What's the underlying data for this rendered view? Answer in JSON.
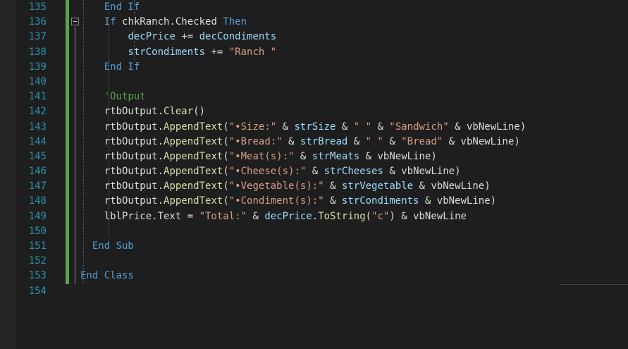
{
  "colors": {
    "background": "#1e1e1e",
    "line_number": "#2b91af",
    "keyword": "#569cd6",
    "string": "#d69d85",
    "comment": "#57a64a",
    "variable": "#9cdcfe",
    "method": "#dcdcaa",
    "change_bar": "#57a64a"
  },
  "lines": [
    {
      "n": "135",
      "indent": "    ",
      "t": [
        [
          "kw",
          "End If"
        ]
      ]
    },
    {
      "n": "136",
      "indent": "    ",
      "t": [
        [
          "kw",
          "If "
        ],
        [
          "d",
          "chkRanch.Checked "
        ],
        [
          "kw",
          "Then"
        ]
      ]
    },
    {
      "n": "137",
      "indent": "        ",
      "t": [
        [
          "var",
          "decPrice"
        ],
        [
          "d",
          " += "
        ],
        [
          "var",
          "decCondiments"
        ]
      ]
    },
    {
      "n": "138",
      "indent": "        ",
      "t": [
        [
          "var",
          "strCondiments"
        ],
        [
          "d",
          " += "
        ],
        [
          "str",
          "\"Ranch \""
        ]
      ]
    },
    {
      "n": "139",
      "indent": "    ",
      "t": [
        [
          "kw",
          "End If"
        ]
      ]
    },
    {
      "n": "140",
      "indent": "",
      "t": []
    },
    {
      "n": "141",
      "indent": "    ",
      "t": [
        [
          "cm",
          "'Output"
        ]
      ]
    },
    {
      "n": "142",
      "indent": "    ",
      "t": [
        [
          "d",
          "rtbOutput."
        ],
        [
          "mth",
          "Clear"
        ],
        [
          "d",
          "()"
        ]
      ]
    },
    {
      "n": "143",
      "indent": "    ",
      "t": [
        [
          "d",
          "rtbOutput."
        ],
        [
          "mth",
          "AppendText"
        ],
        [
          "d",
          "("
        ],
        [
          "str",
          "\"•Size:\""
        ],
        [
          "d",
          " & "
        ],
        [
          "var",
          "strSize"
        ],
        [
          "d",
          " & "
        ],
        [
          "str",
          "\" \""
        ],
        [
          "d",
          " & "
        ],
        [
          "str",
          "\"Sandwich\""
        ],
        [
          "d",
          " & vbNewLine)"
        ]
      ]
    },
    {
      "n": "144",
      "indent": "    ",
      "t": [
        [
          "d",
          "rtbOutput."
        ],
        [
          "mth",
          "AppendText"
        ],
        [
          "d",
          "("
        ],
        [
          "str",
          "\"•Bread:\""
        ],
        [
          "d",
          " & "
        ],
        [
          "var",
          "strBread"
        ],
        [
          "d",
          " & "
        ],
        [
          "str",
          "\" \""
        ],
        [
          "d",
          " & "
        ],
        [
          "str",
          "\"Bread\""
        ],
        [
          "d",
          " & vbNewLine)"
        ]
      ]
    },
    {
      "n": "145",
      "indent": "    ",
      "t": [
        [
          "d",
          "rtbOutput."
        ],
        [
          "mth",
          "AppendText"
        ],
        [
          "d",
          "("
        ],
        [
          "str",
          "\"•Meat(s):\""
        ],
        [
          "d",
          " & "
        ],
        [
          "var",
          "strMeats"
        ],
        [
          "d",
          " & vbNewLine)"
        ]
      ]
    },
    {
      "n": "146",
      "indent": "    ",
      "t": [
        [
          "d",
          "rtbOutput."
        ],
        [
          "mth",
          "AppendText"
        ],
        [
          "d",
          "("
        ],
        [
          "str",
          "\"•Cheese(s):\""
        ],
        [
          "d",
          " & "
        ],
        [
          "var",
          "strCheeses"
        ],
        [
          "d",
          " & vbNewLine)"
        ]
      ]
    },
    {
      "n": "147",
      "indent": "    ",
      "t": [
        [
          "d",
          "rtbOutput."
        ],
        [
          "mth",
          "AppendText"
        ],
        [
          "d",
          "("
        ],
        [
          "str",
          "\"•Vegetable(s):\""
        ],
        [
          "d",
          " & "
        ],
        [
          "var",
          "strVegetable"
        ],
        [
          "d",
          " & vbNewLine)"
        ]
      ]
    },
    {
      "n": "148",
      "indent": "    ",
      "t": [
        [
          "d",
          "rtbOutput."
        ],
        [
          "mth",
          "AppendText"
        ],
        [
          "d",
          "("
        ],
        [
          "str",
          "\"•Condiment(s):\""
        ],
        [
          "d",
          " & "
        ],
        [
          "var",
          "strCondiments"
        ],
        [
          "d",
          " & vbNewLine)"
        ]
      ]
    },
    {
      "n": "149",
      "indent": "    ",
      "t": [
        [
          "d",
          "lblPrice.Text = "
        ],
        [
          "str",
          "\"Total:\""
        ],
        [
          "d",
          " & "
        ],
        [
          "var",
          "decPrice"
        ],
        [
          "d",
          "."
        ],
        [
          "mth",
          "ToString"
        ],
        [
          "d",
          "("
        ],
        [
          "str",
          "\"c\""
        ],
        [
          "d",
          ") & vbNewLine"
        ]
      ]
    },
    {
      "n": "150",
      "indent": "",
      "t": []
    },
    {
      "n": "151",
      "indent": "  ",
      "t": [
        [
          "kw",
          "End Sub"
        ]
      ]
    },
    {
      "n": "152",
      "indent": "",
      "t": []
    },
    {
      "n": "153",
      "indent": "",
      "t": [
        [
          "kw",
          "End Class"
        ]
      ]
    },
    {
      "n": "154",
      "indent": "",
      "t": []
    }
  ]
}
